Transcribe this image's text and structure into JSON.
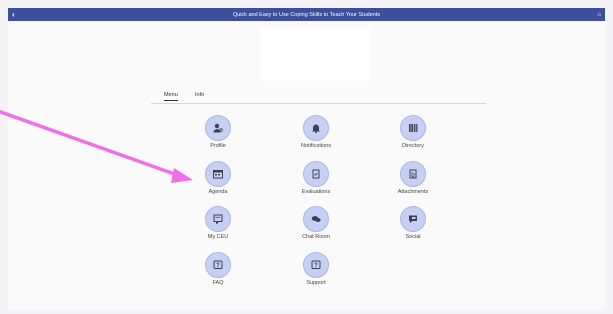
{
  "header": {
    "title": "Quick and Easy to Use Coping Skills to Teach Your Students",
    "back_glyph": "‹",
    "home_glyph": "⌂"
  },
  "tabs": [
    {
      "label": "Menu",
      "active": true
    },
    {
      "label": "Info",
      "active": false
    }
  ],
  "menu_items": [
    {
      "label": "Profile",
      "icon": "person-search-icon"
    },
    {
      "label": "Notifications",
      "icon": "bell-icon"
    },
    {
      "label": "Directory",
      "icon": "directory-icon"
    },
    {
      "label": "Agenda",
      "icon": "calendar-icon"
    },
    {
      "label": "Evaluations",
      "icon": "evaluation-icon"
    },
    {
      "label": "Attachments",
      "icon": "attachment-icon"
    },
    {
      "label": "My CEU",
      "icon": "certificate-icon"
    },
    {
      "label": "Chat Room",
      "icon": "chat-icon"
    },
    {
      "label": "Social",
      "icon": "social-icon"
    },
    {
      "label": "FAQ",
      "icon": "question-icon"
    },
    {
      "label": "Support",
      "icon": "support-icon"
    }
  ],
  "colors": {
    "header": "#3d4e9c",
    "tile_circle": "#c6d0f2",
    "icon": "#3a3f5a",
    "annotation_arrow": "#f06ee8"
  }
}
